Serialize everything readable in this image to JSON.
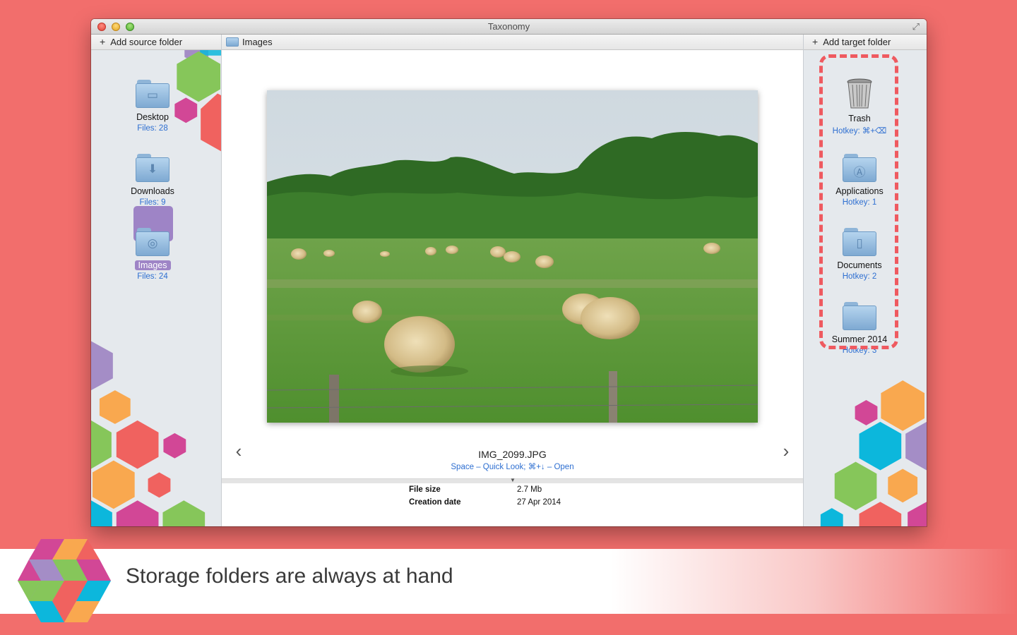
{
  "window": {
    "title": "Taxonomy"
  },
  "left_sidebar": {
    "header_icon": "plus-icon",
    "header_label": "Add source folder",
    "folders": [
      {
        "name": "Desktop",
        "meta": "Files: 28",
        "icon": "desktop-folder-icon"
      },
      {
        "name": "Downloads",
        "meta": "Files: 9",
        "icon": "downloads-folder-icon"
      },
      {
        "name": "Images",
        "meta": "Files: 24",
        "icon": "images-folder-icon",
        "selected": true
      }
    ]
  },
  "center": {
    "path_label": "Images",
    "filename": "IMG_2099.JPG",
    "shortcuts": "Space – Quick Look; ⌘+↓ – Open",
    "prev_icon": "chevron-left-icon",
    "next_icon": "chevron-right-icon",
    "info": [
      {
        "label": "File size",
        "value": "2.7 Mb"
      },
      {
        "label": "Creation date",
        "value": "27 Apr 2014"
      }
    ]
  },
  "right_sidebar": {
    "header_icon": "plus-icon",
    "header_label": "Add target folder",
    "targets": [
      {
        "name": "Trash",
        "meta": "Hotkey: ⌘+⌫",
        "icon": "trash-icon"
      },
      {
        "name": "Applications",
        "meta": "Hotkey: 1",
        "icon": "applications-folder-icon"
      },
      {
        "name": "Documents",
        "meta": "Hotkey: 2",
        "icon": "documents-folder-icon"
      },
      {
        "name": "Summer 2014",
        "meta": "Hotkey: 3",
        "icon": "folder-icon"
      }
    ]
  },
  "banner": {
    "tagline": "Storage folders are always at hand"
  },
  "colors": {
    "background": "#f26e6c",
    "accent_blue": "#2e6fd1",
    "selection": "#9e84c6",
    "dashed_highlight": "#ef5a60",
    "hex_green": "#86c65a",
    "hex_orange": "#f9a84f",
    "hex_magenta": "#d24796",
    "hex_cyan": "#0cb7dc",
    "hex_purple": "#a48dc6",
    "hex_red": "#f0625f"
  }
}
